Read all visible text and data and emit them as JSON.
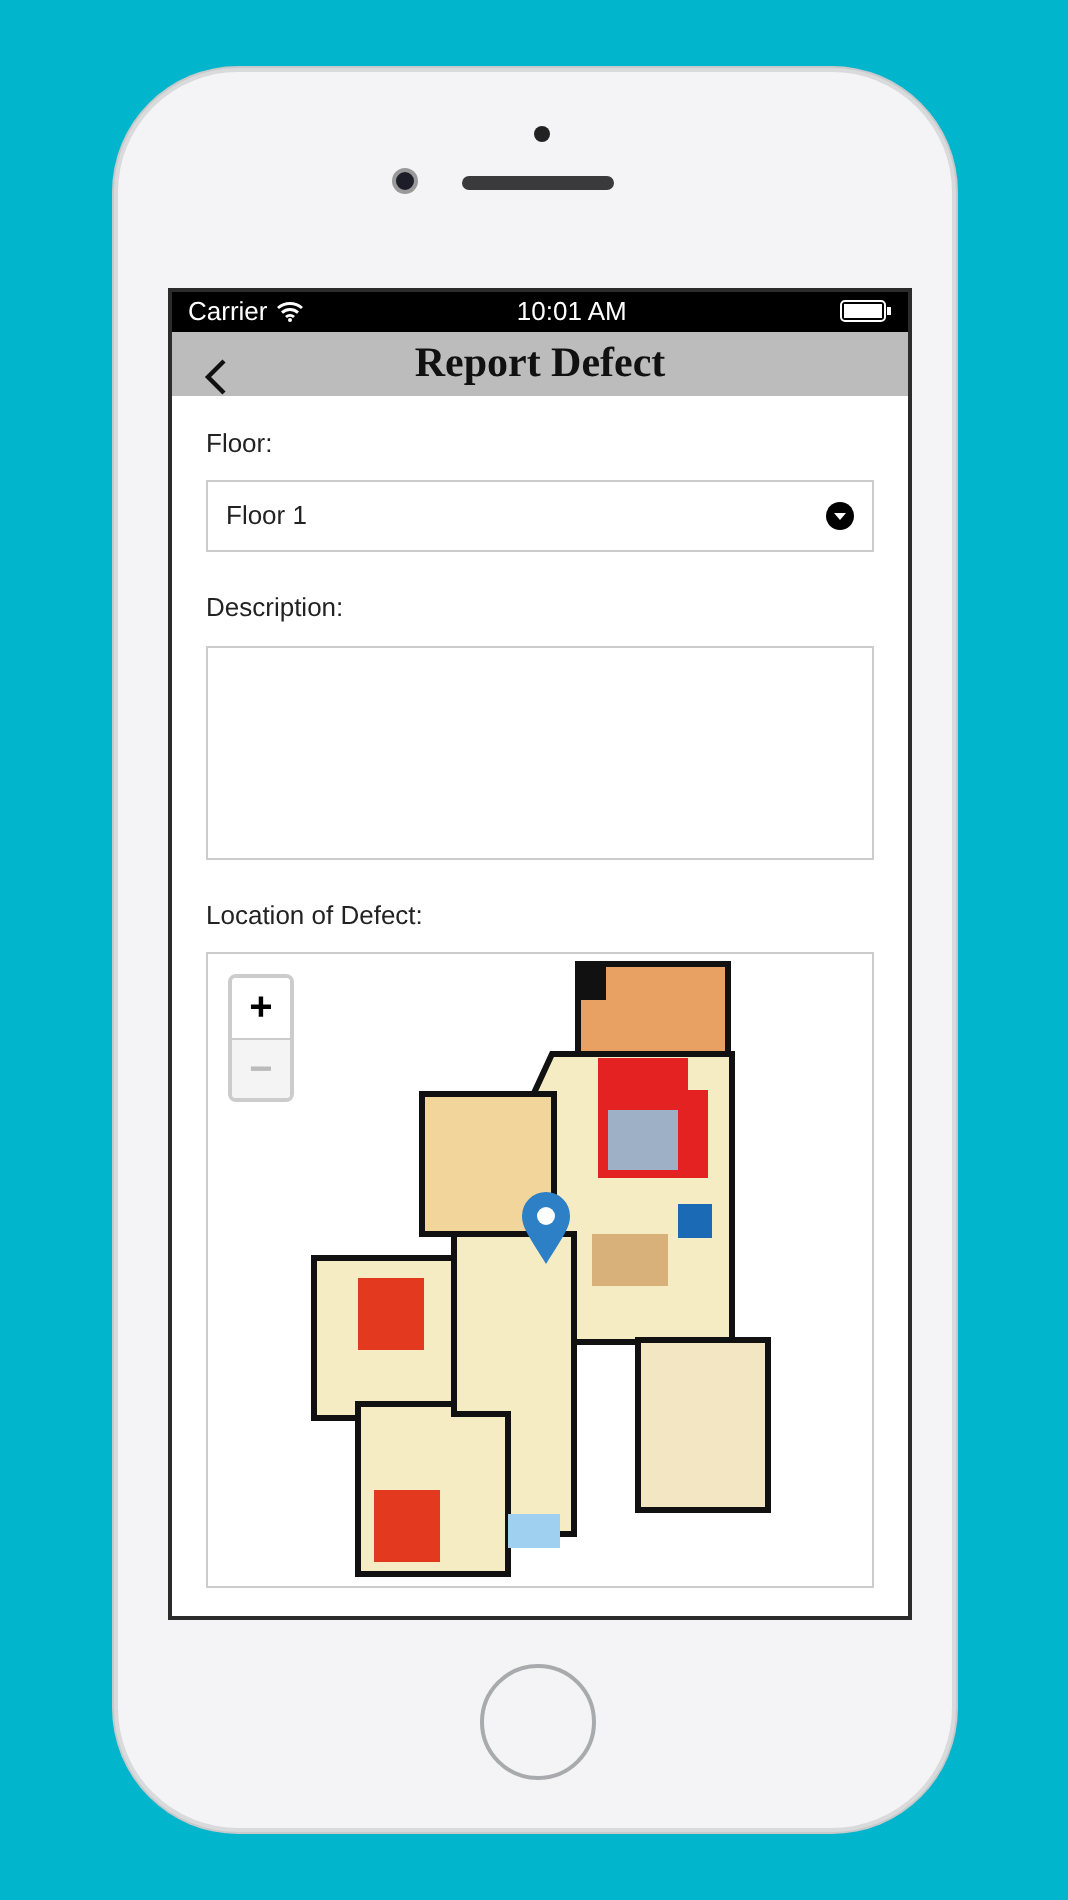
{
  "status_bar": {
    "carrier": "Carrier",
    "time": "10:01 AM"
  },
  "nav_bar": {
    "title": "Report Defect"
  },
  "form": {
    "floor": {
      "label": "Floor:",
      "value": "Floor 1"
    },
    "description": {
      "label": "Description:"
    },
    "location": {
      "label": "Location of Defect:",
      "zoom_in": {
        "label": "+",
        "disabled": false
      },
      "zoom_out": {
        "label": "−",
        "disabled": true
      }
    }
  }
}
